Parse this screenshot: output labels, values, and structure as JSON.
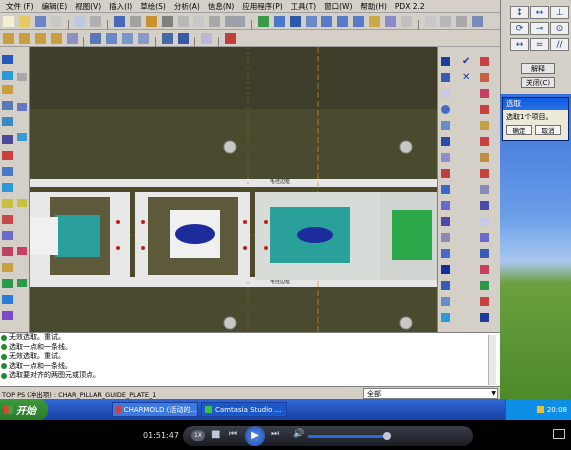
{
  "menu": [
    "文件 (F)",
    "编辑(E)",
    "视图(V)",
    "插入(I)",
    "草绘(S)",
    "分析(A)",
    "信息(N)",
    "应用程序(P)",
    "工具(T)",
    "窗口(W)",
    "帮助(H)",
    "PDX 2.2"
  ],
  "panel": {
    "reset_label": "解释",
    "close_label": "关闭(C)"
  },
  "dialog": {
    "title": "选取",
    "text": "选取1个项目。",
    "ok_label": "确定",
    "cancel_label": "取消"
  },
  "canvas": {
    "label_top": "毛坯边框",
    "label_bottom": "毛坯边框"
  },
  "messages": [
    "无效选取。重试。",
    "选取一点和一条线。",
    "无效选取。重试。",
    "选取一点和一条线。",
    "选取要对齐的两图元或顶点。"
  ],
  "status": {
    "text": "TOP PS (冲出项) : CHAR_PILLAR_GUIDE_PLATE_1",
    "filter": "全部"
  },
  "taskbar": {
    "start_label": "开始",
    "tasks": [
      "CHARMOLD (活动的...",
      "Camtasia Studio ..."
    ],
    "clock": "20:08"
  },
  "media": {
    "time": "01:51:47",
    "speed": "1X"
  },
  "colors": {
    "canvas_bg": "#4a4a2a",
    "plate": "#d8dcd8",
    "teal": "#2aa09a",
    "blue": "#1c2c9c",
    "green": "#2ca84a"
  }
}
